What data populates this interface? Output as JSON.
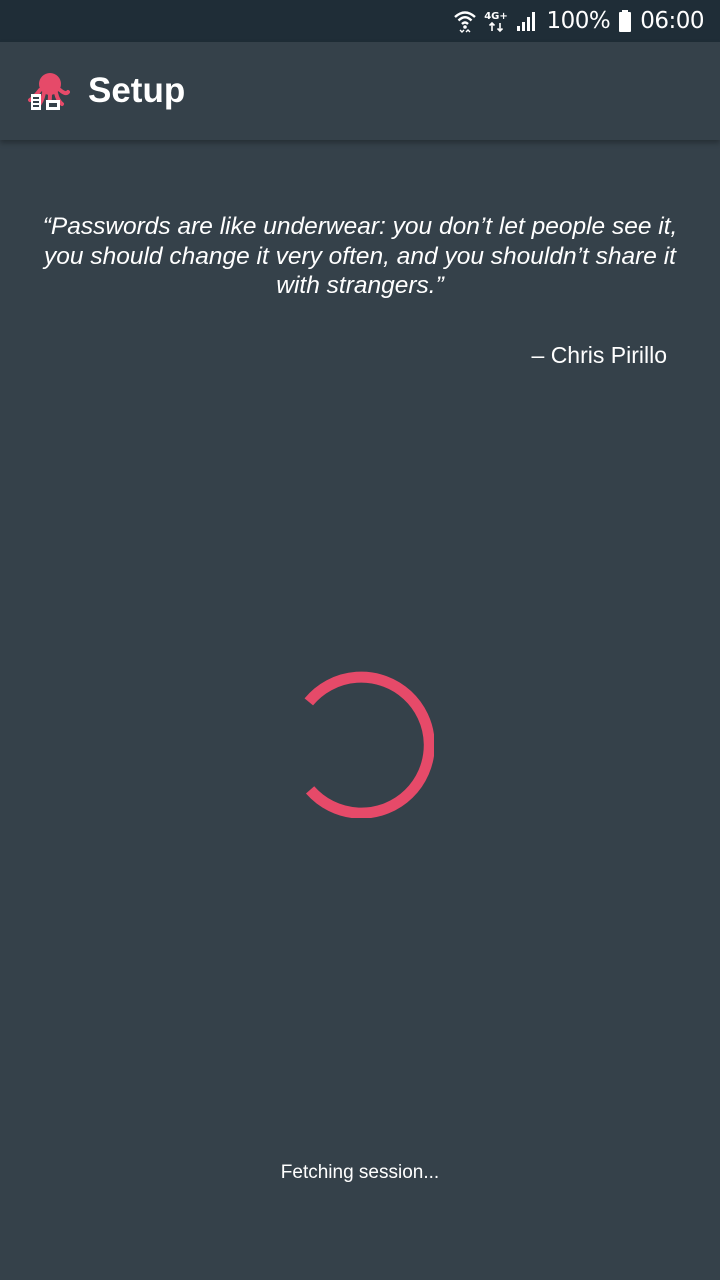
{
  "status_bar": {
    "battery_percent": "100%",
    "time": "06:00",
    "network_label": "4G+",
    "icons": [
      "wifi-icon",
      "network-4g-icon",
      "signal-icon",
      "battery-icon"
    ]
  },
  "app_bar": {
    "title": "Setup",
    "logo_icon": "octopus-logo-icon"
  },
  "quote": {
    "text": "“Passwords are like underwear: you don’t let people see it, you should change it very often, and you shouldn’t share it with strangers.”",
    "author": "– Chris Pirillo"
  },
  "loading": {
    "status_text": "Fetching session...",
    "spinner_icon": "loading-spinner-icon"
  },
  "colors": {
    "background": "#35414a",
    "status_bar": "#1f2d37",
    "accent": "#e64a69",
    "text": "#ffffff"
  }
}
